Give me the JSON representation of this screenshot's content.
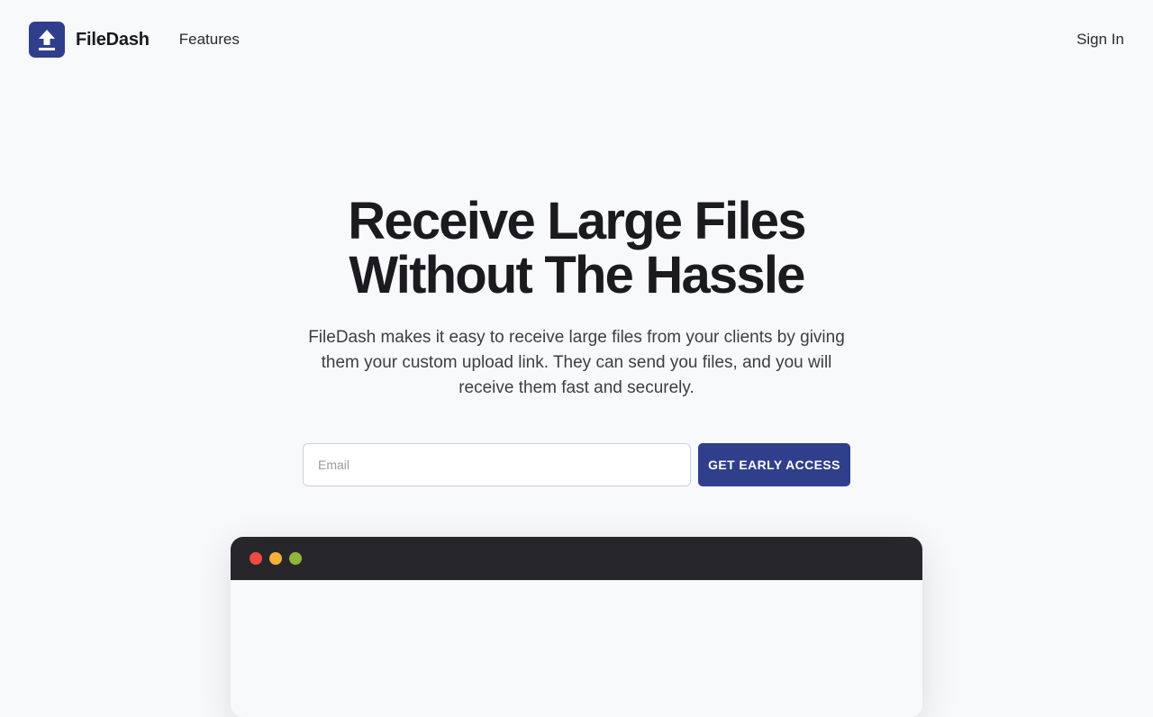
{
  "nav": {
    "brand": "FileDash",
    "logo_icon": "upload-icon",
    "features_label": "Features",
    "signin_label": "Sign In"
  },
  "hero": {
    "title_line1": "Receive Large Files",
    "title_line2": "Without The Hassle",
    "subtitle": "FileDash makes it easy to receive large files from your clients by giving them your custom upload link. They can send you files, and you will receive them fast and securely."
  },
  "signup": {
    "email_placeholder": "Email",
    "email_value": "",
    "cta_label": "GET EARLY ACCESS"
  },
  "preview": {
    "dot_colors": [
      "#f04a43",
      "#f5b03a",
      "#8fb63a"
    ]
  },
  "colors": {
    "brand": "#303f8c",
    "background": "#f8f9fb",
    "preview_bar": "#26262b"
  }
}
